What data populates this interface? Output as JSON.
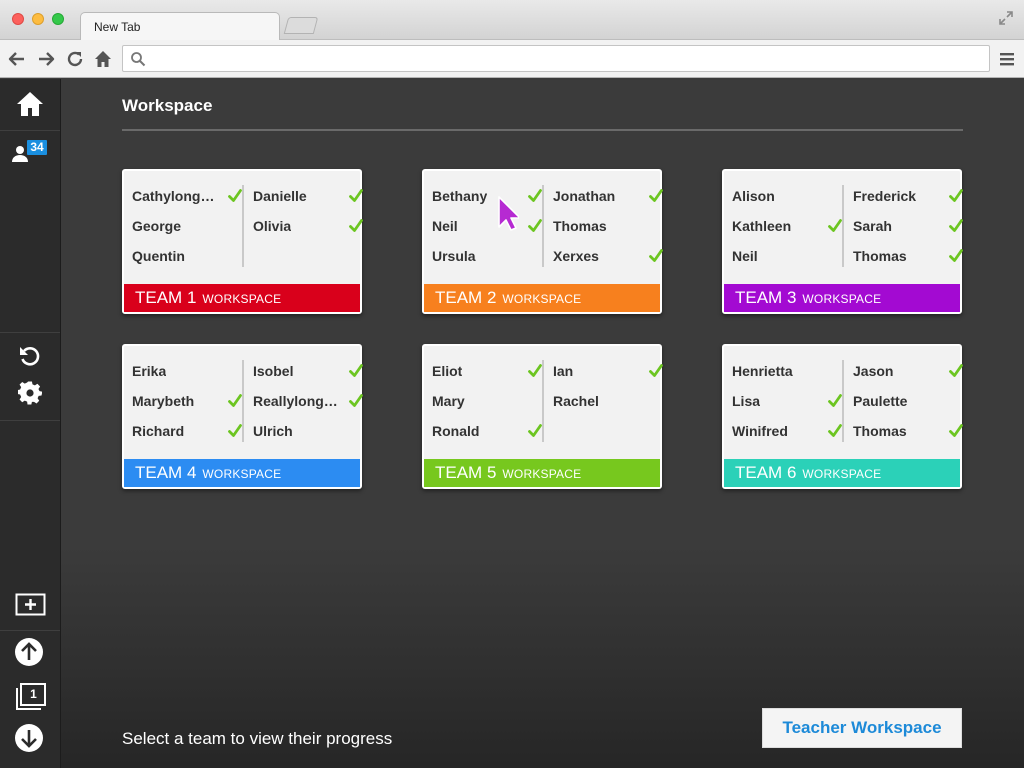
{
  "browser": {
    "tab_title": "New Tab",
    "address_value": "",
    "address_placeholder": ""
  },
  "icons": {
    "back": "arrow-left-icon",
    "forward": "arrow-right-icon",
    "reload": "reload-icon",
    "home": "home-icon",
    "search": "search-icon",
    "menu": "hamburger-menu-icon",
    "fullscreen": "fullscreen-icon",
    "check": "check-icon"
  },
  "sidebar": {
    "participants_badge": "34",
    "page_number": "1"
  },
  "workspace": {
    "title": "Workspace",
    "footer_suffix": "WORKSPACE",
    "teams": [
      {
        "name": "TEAM 1",
        "color": "#d9001b",
        "left": [
          {
            "name": "Cathylong…",
            "done": true
          },
          {
            "name": "George",
            "done": false
          },
          {
            "name": "Quentin",
            "done": false
          }
        ],
        "right": [
          {
            "name": "Danielle",
            "done": true
          },
          {
            "name": "Olivia",
            "done": true
          }
        ]
      },
      {
        "name": "TEAM 2",
        "color": "#f7801e",
        "left": [
          {
            "name": "Bethany",
            "done": true
          },
          {
            "name": "Neil",
            "done": true
          },
          {
            "name": "Ursula",
            "done": false
          }
        ],
        "right": [
          {
            "name": "Jonathan",
            "done": true
          },
          {
            "name": "Thomas",
            "done": false
          },
          {
            "name": "Xerxes",
            "done": true
          }
        ]
      },
      {
        "name": "TEAM 3",
        "color": "#a30ad2",
        "left": [
          {
            "name": "Alison",
            "done": false
          },
          {
            "name": "Kathleen",
            "done": true
          },
          {
            "name": "Neil",
            "done": false
          }
        ],
        "right": [
          {
            "name": "Frederick",
            "done": true
          },
          {
            "name": "Sarah",
            "done": true
          },
          {
            "name": "Thomas",
            "done": true
          }
        ]
      },
      {
        "name": "TEAM 4",
        "color": "#2c8cf2",
        "left": [
          {
            "name": "Erika",
            "done": false
          },
          {
            "name": "Marybeth",
            "done": true
          },
          {
            "name": "Richard",
            "done": true
          }
        ],
        "right": [
          {
            "name": "Isobel",
            "done": true
          },
          {
            "name": "Reallylong…",
            "done": true
          },
          {
            "name": "Ulrich",
            "done": false
          }
        ]
      },
      {
        "name": "TEAM 5",
        "color": "#77c81e",
        "left": [
          {
            "name": "Eliot",
            "done": true
          },
          {
            "name": "Mary",
            "done": false
          },
          {
            "name": "Ronald",
            "done": true
          }
        ],
        "right": [
          {
            "name": "Ian",
            "done": true
          },
          {
            "name": "Rachel",
            "done": false
          }
        ]
      },
      {
        "name": "TEAM 6",
        "color": "#2bd1b8",
        "left": [
          {
            "name": "Henrietta",
            "done": false
          },
          {
            "name": "Lisa",
            "done": true
          },
          {
            "name": "Winifred",
            "done": true
          }
        ],
        "right": [
          {
            "name": "Jason",
            "done": true
          },
          {
            "name": "Paulette",
            "done": false
          },
          {
            "name": "Thomas",
            "done": true
          }
        ]
      }
    ]
  },
  "footer": {
    "status_text": "Select a team to view their progress",
    "teacher_button_label": "Teacher Workspace"
  },
  "colors": {
    "check": "#6cc521",
    "accent": "#1d8ad8",
    "badge": "#1a8fe0"
  }
}
